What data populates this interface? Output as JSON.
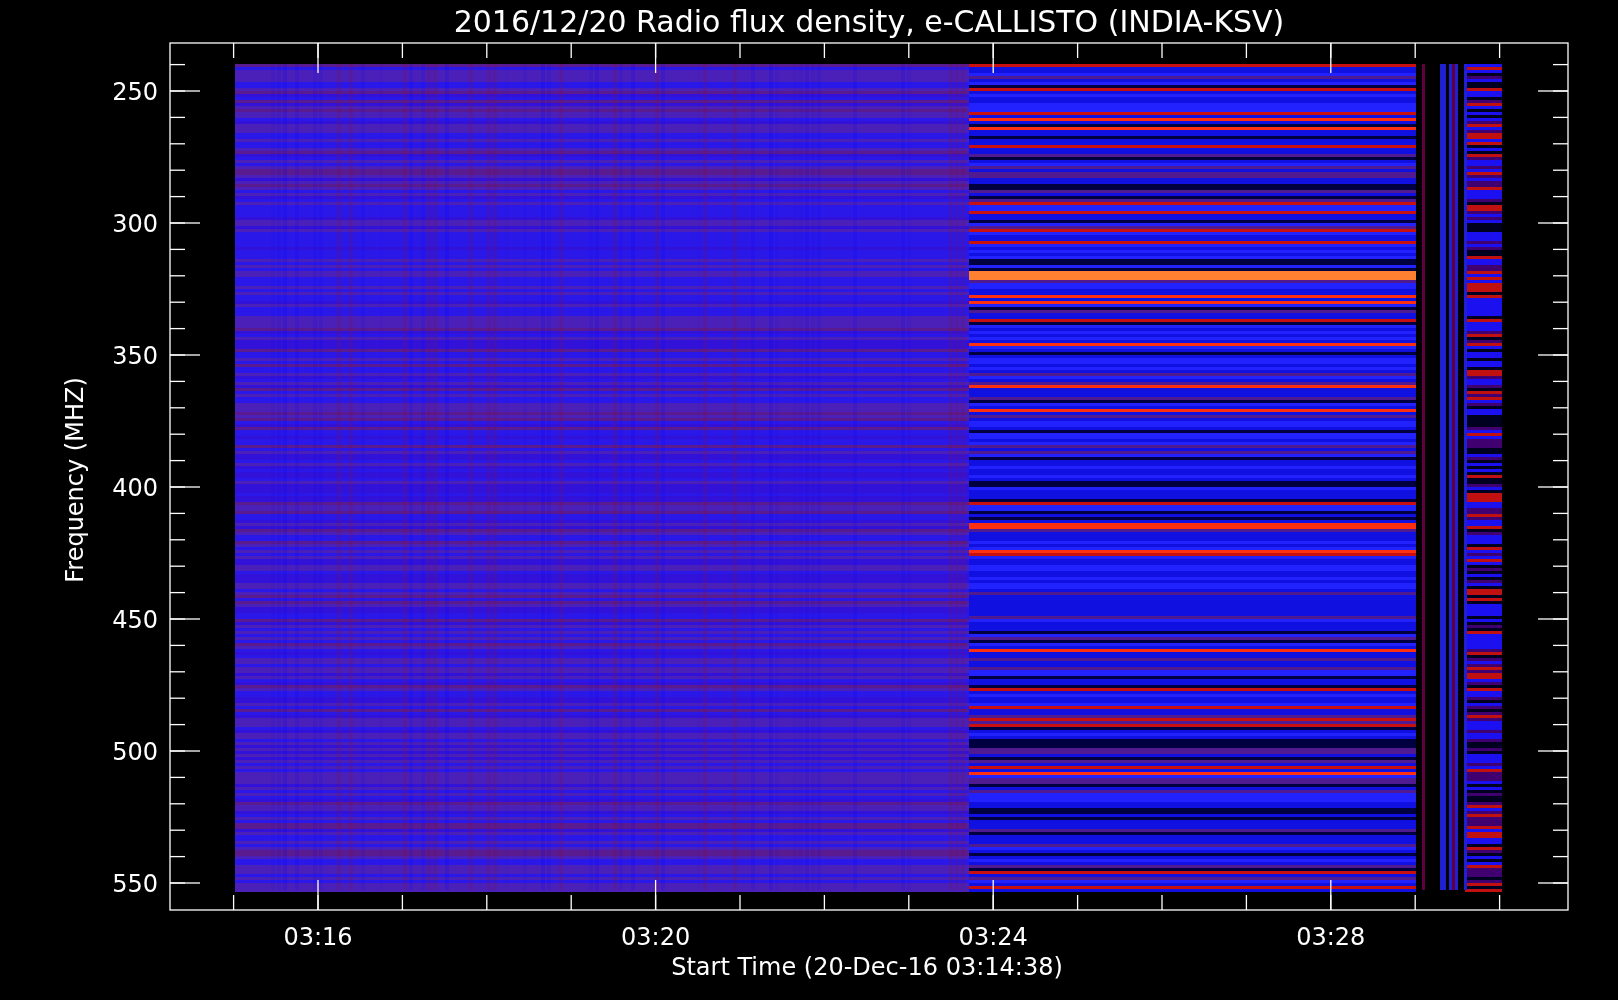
{
  "title": "2016/12/20  Radio flux density, e-CALLISTO (INDIA-KSV)",
  "y_axis": {
    "label": "Frequency (MHZ)",
    "ticks": [
      "250",
      "300",
      "350",
      "400",
      "450",
      "500",
      "550"
    ]
  },
  "x_axis": {
    "label": "Start Time (20-Dec-16 03:14:38)",
    "ticks": [
      "03:16",
      "03:20",
      "03:24",
      "03:28"
    ]
  }
}
